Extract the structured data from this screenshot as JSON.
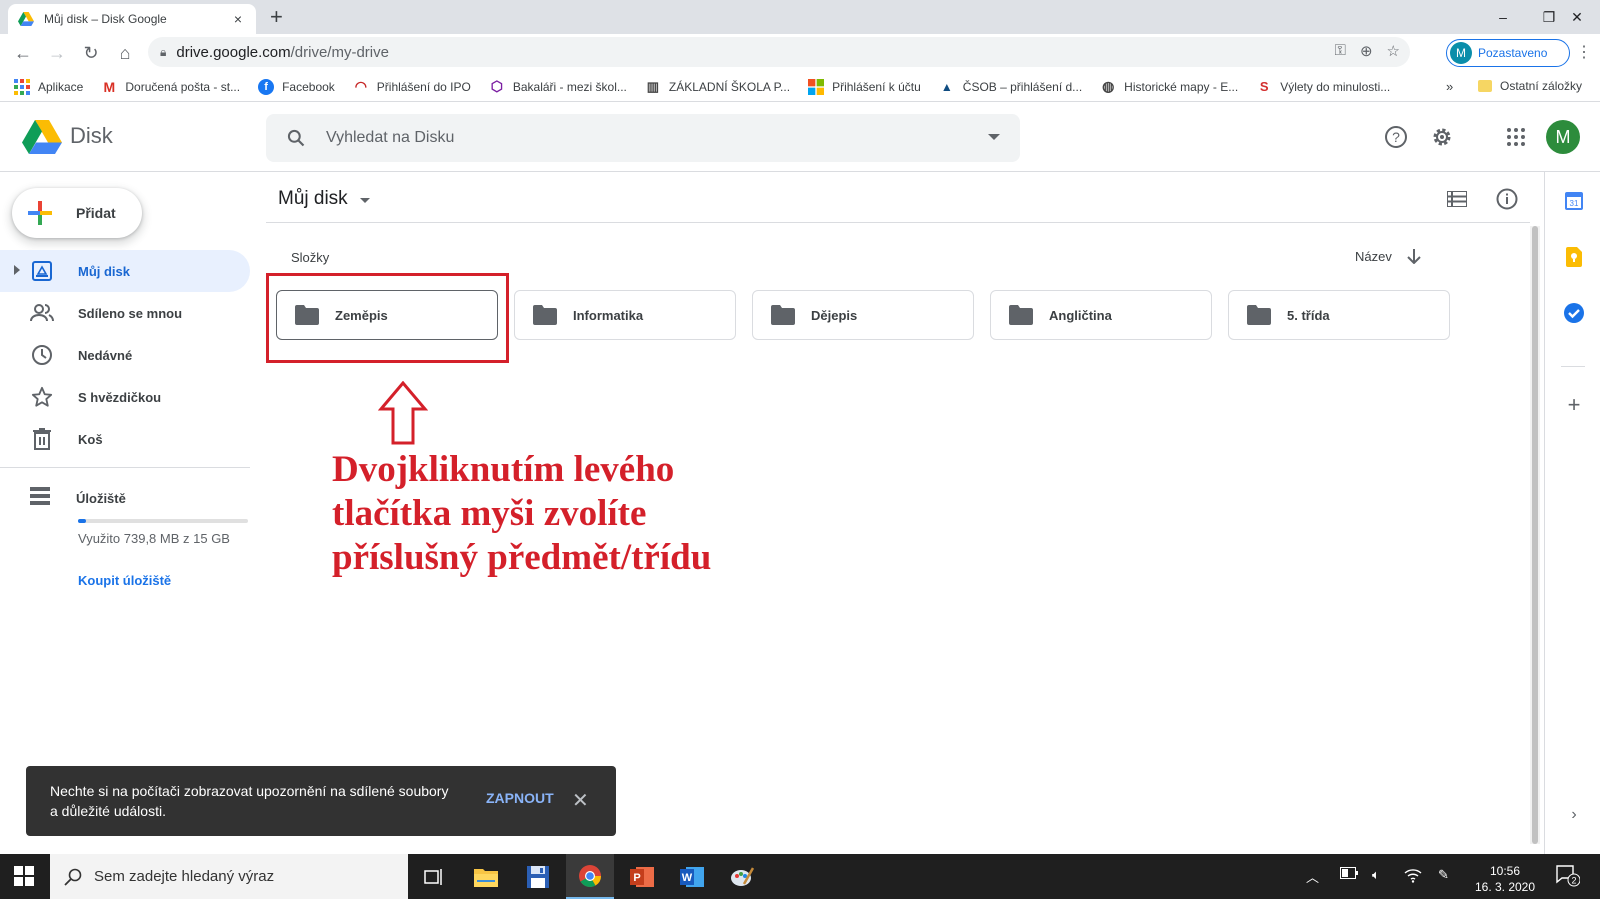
{
  "browser": {
    "tab_title": "Můj disk – Disk Google",
    "tab_close": "×",
    "new_tab": "+",
    "url_host": "drive.google.com",
    "url_path": "/drive/my-drive",
    "profile_initial": "M",
    "profile_label": "Pozastaveno",
    "window_controls": [
      "–",
      "❐",
      "✕"
    ]
  },
  "bookmarks": {
    "items": [
      {
        "label": "Aplikace",
        "icon": "apps-grid-icon"
      },
      {
        "label": "Doručená pošta - st...",
        "icon": "gmail-icon"
      },
      {
        "label": "Facebook",
        "icon": "facebook-icon"
      },
      {
        "label": "Přihlášení do IPO",
        "icon": "ipo-icon"
      },
      {
        "label": "Bakaláři - mezi škol...",
        "icon": "bakalari-icon"
      },
      {
        "label": "ZÁKLADNÍ ŠKOLA P...",
        "icon": "book-icon"
      },
      {
        "label": "Přihlášení k účtu",
        "icon": "microsoft-icon"
      },
      {
        "label": "ČSOB – přihlášení d...",
        "icon": "csob-icon"
      },
      {
        "label": "Historické mapy - E...",
        "icon": "globe-icon"
      },
      {
        "label": "Výlety do minulosti...",
        "icon": "s-icon"
      }
    ],
    "more": "»",
    "other_label": "Ostatní záložky"
  },
  "drive": {
    "app_name": "Disk",
    "search_placeholder": "Vyhledat na Disku",
    "user_initial": "M",
    "new_button": "Přidat",
    "nav": [
      {
        "label": "Můj disk",
        "icon": "my-drive-icon",
        "active": true
      },
      {
        "label": "Sdíleno se mnou",
        "icon": "shared-icon",
        "active": false
      },
      {
        "label": "Nedávné",
        "icon": "clock-icon",
        "active": false
      },
      {
        "label": "S hvězdičkou",
        "icon": "star-icon",
        "active": false
      },
      {
        "label": "Koš",
        "icon": "trash-icon",
        "active": false
      }
    ],
    "storage_label": "Úložiště",
    "storage_used": "Využito 739,8 MB z 15 GB",
    "storage_fraction": 0.048,
    "buy_storage": "Koupit úložiště",
    "breadcrumb": "Můj disk",
    "section_label": "Složky",
    "sort_label": "Název",
    "folders": [
      "Zeměpis",
      "Informatika",
      "Dějepis",
      "Angličtina",
      "5. třída"
    ]
  },
  "annotation": {
    "lines": [
      "Dvojkliknutím levého",
      "tlačítka myši zvolíte",
      "příslušný předmět/třídu"
    ],
    "color": "#d4202a"
  },
  "snackbar": {
    "message": "Nechte si na počítači zobrazovat upozornění na sdílené soubory a důležité události.",
    "action": "ZAPNOUT",
    "close": "✕"
  },
  "taskbar": {
    "search_placeholder": "Sem zadejte hledaný výraz",
    "time": "10:56",
    "date": "16. 3. 2020",
    "notifications": "2"
  }
}
